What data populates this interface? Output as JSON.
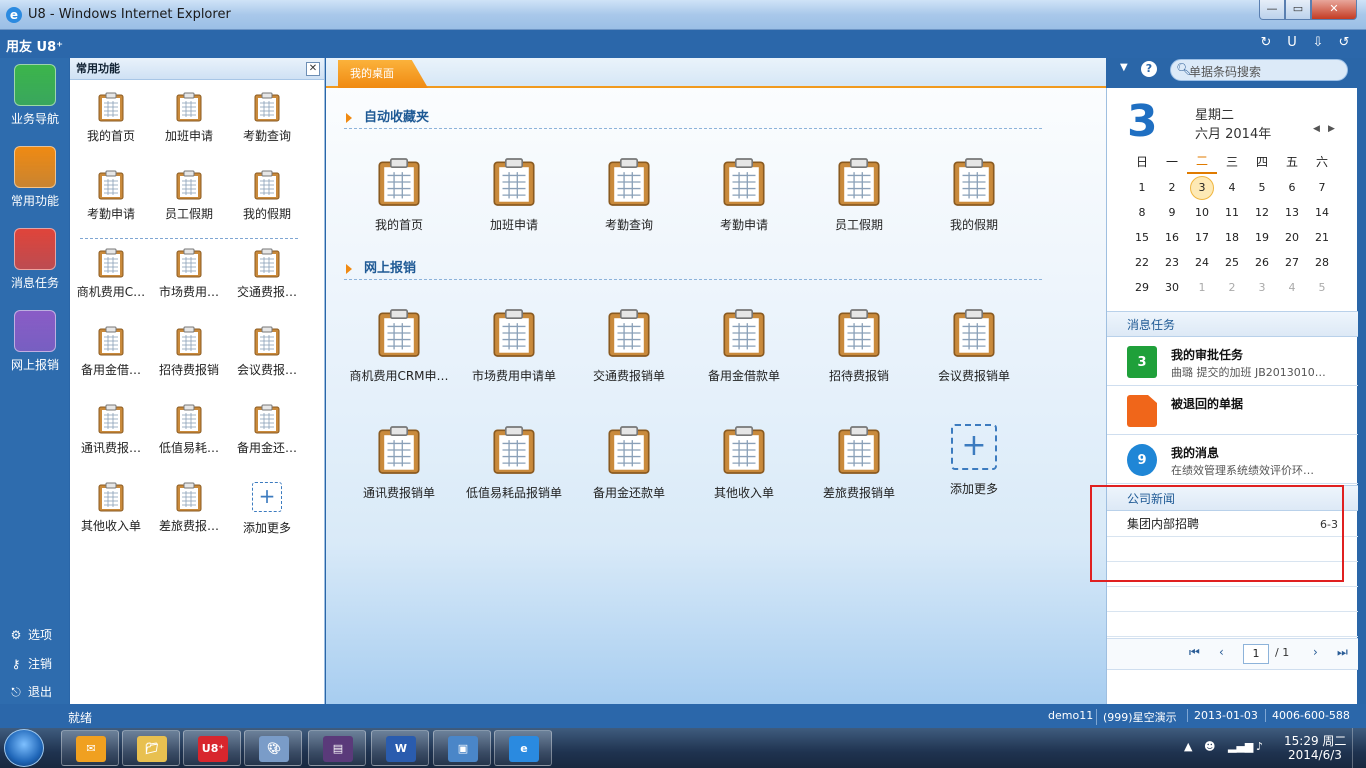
{
  "window": {
    "title": "U8 - Windows Internet Explorer",
    "min": "—",
    "max": "▭",
    "close": "✕"
  },
  "topbar": {
    "logo": "用友 U8⁺"
  },
  "leftnav": [
    {
      "label": "业务导航",
      "icon": "business-nav-icon",
      "color": "#3cb54a"
    },
    {
      "label": "常用功能",
      "icon": "common-functions-icon",
      "color": "#f08a12"
    },
    {
      "label": "消息任务",
      "icon": "message-task-icon",
      "color": "#e0443a"
    },
    {
      "label": "网上报销",
      "icon": "online-reimburse-icon",
      "color": "#8a5cc6"
    }
  ],
  "system": [
    {
      "label": "选项",
      "glyph": "⚙"
    },
    {
      "label": "注销",
      "glyph": "⚷"
    },
    {
      "label": "退出",
      "glyph": "⎋"
    }
  ],
  "favpanel": {
    "title": "常用功能",
    "close": "✕",
    "items": [
      "我的首页",
      "加班申请",
      "考勤查询",
      "考勤申请",
      "员工假期",
      "我的假期",
      "商机费用C…",
      "市场费用…",
      "交通费报…",
      "备用金借…",
      "招待费报销",
      "会议费报…",
      "通讯费报…",
      "低值易耗…",
      "备用金还…",
      "其他收入单",
      "差旅费报…"
    ],
    "add_label": "添加更多"
  },
  "main": {
    "tab": "我的桌面",
    "sections": [
      {
        "title": "自动收藏夹",
        "items": [
          "我的首页",
          "加班申请",
          "考勤查询",
          "考勤申请",
          "员工假期",
          "我的假期"
        ]
      },
      {
        "title": "网上报销",
        "items": [
          "商机费用CRM申…",
          "市场费用申请单",
          "交通费报销单",
          "备用金借款单",
          "招待费报销",
          "会议费报销单",
          "通讯费报销单",
          "低值易耗品报销单",
          "备用金还款单",
          "其他收入单",
          "差旅费报销单"
        ]
      }
    ],
    "add_label": "添加更多"
  },
  "search": {
    "placeholder": "单据条码搜索"
  },
  "calendar": {
    "day": "3",
    "weekday": "星期二",
    "month_year": "六月  2014年",
    "headers": [
      "日",
      "一",
      "二",
      "三",
      "四",
      "五",
      "六"
    ],
    "days": [
      "1",
      "2",
      "3",
      "4",
      "5",
      "6",
      "7",
      "8",
      "9",
      "10",
      "11",
      "12",
      "13",
      "14",
      "15",
      "16",
      "17",
      "18",
      "19",
      "20",
      "21",
      "22",
      "23",
      "24",
      "25",
      "26",
      "27",
      "28",
      "29",
      "30",
      "1",
      "2",
      "3",
      "4",
      "5"
    ],
    "current_day": "3"
  },
  "messages": {
    "title": "消息任务",
    "items": [
      {
        "title": "我的审批任务",
        "desc": "曲璐 提交的加班 JB2013010…",
        "badge": "3",
        "color": "#1fa03a"
      },
      {
        "title": "被退回的单据",
        "desc": "",
        "badge": "",
        "color": "#f0661a"
      },
      {
        "title": "我的消息",
        "desc": "在绩效管理系统绩效评价环…",
        "badge": "9",
        "color": "#1f86d6"
      }
    ]
  },
  "news": {
    "title": "公司新闻",
    "items": [
      {
        "title": "集团内部招聘",
        "date": "6-3"
      }
    ]
  },
  "pager": {
    "first": "⏮",
    "prev": "‹",
    "page": "1",
    "total": "/ 1",
    "next": "›",
    "last": "⏭"
  },
  "statusbar": {
    "status": "就绪",
    "user": "demo11",
    "account": "(999)星空演示",
    "date": "2013-01-03",
    "phone": "4006-600-588"
  },
  "taskbar": {
    "time": "15:29 周二",
    "date": "2014/6/3",
    "apps": [
      "outlook-icon",
      "explorer-icon",
      "u8-icon",
      "paint-icon",
      "winrar-icon",
      "word-icon",
      "photo-icon",
      "ie-icon"
    ]
  }
}
